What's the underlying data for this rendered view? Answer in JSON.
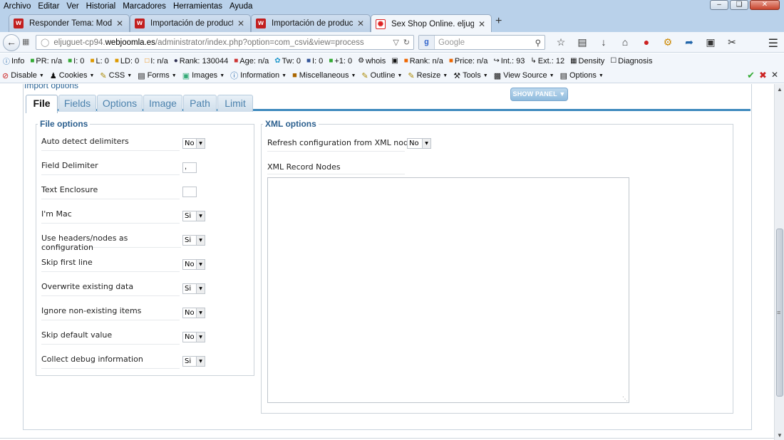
{
  "browser": {
    "menu": [
      "Archivo",
      "Editar",
      "Ver",
      "Historial",
      "Marcadores",
      "Herramientas",
      "Ayuda"
    ],
    "tabs": [
      {
        "label": "Responder Tema: Modifica...",
        "active": false
      },
      {
        "label": "Importación de productos ...",
        "active": false
      },
      {
        "label": "Importación de productos ...",
        "active": false
      },
      {
        "label": "Sex Shop Online. eljuguete...",
        "active": true
      }
    ],
    "url_prefix": "eljuguet-cp94.",
    "url_domain": "webjoomla.es",
    "url_path": "/administrator/index.php?option=com_csvi&view=process",
    "search_placeholder": "Google",
    "search_engine_letter": "g"
  },
  "seo_toolbar": [
    {
      "icon": "info-icon",
      "text": "Info"
    },
    {
      "icon": "google-pr-icon",
      "text": "PR: n/a"
    },
    {
      "icon": "google-index-icon",
      "text": "I: 0"
    },
    {
      "icon": "links-icon",
      "text": "L: 0"
    },
    {
      "icon": "linkdomains-icon",
      "text": "LD: 0"
    },
    {
      "icon": "bing-index-icon",
      "text": "I: n/a"
    },
    {
      "icon": "alexa-icon",
      "text": "Rank: 130044"
    },
    {
      "icon": "age-icon",
      "text": "Age: n/a"
    },
    {
      "icon": "twitter-icon",
      "text": "Tw: 0"
    },
    {
      "icon": "facebook-icon",
      "text": "I: 0"
    },
    {
      "icon": "gplus-icon",
      "text": "+1: 0"
    },
    {
      "icon": "whois-icon",
      "text": "whois"
    },
    {
      "icon": "source-icon",
      "text": ""
    },
    {
      "icon": "semrush-rank-icon",
      "text": "Rank: n/a"
    },
    {
      "icon": "semrush-price-icon",
      "text": "Price: n/a"
    },
    {
      "icon": "internal-links-icon",
      "text": "Int.: 93"
    },
    {
      "icon": "external-links-icon",
      "text": "Ext.: 12"
    },
    {
      "icon": "density-icon",
      "text": "Density"
    },
    {
      "icon": "diagnosis-icon",
      "text": "Diagnosis"
    }
  ],
  "dev_toolbar": [
    "Disable",
    "Cookies",
    "CSS",
    "Forms",
    "Images",
    "Information",
    "Miscellaneous",
    "Outline",
    "Resize",
    "Tools",
    "View Source",
    "Options"
  ],
  "page": {
    "section_legend": "Import options",
    "show_panel": "SHOW PANEL",
    "tabs": [
      {
        "label": "File",
        "active": true
      },
      {
        "label": "Fields",
        "active": false
      },
      {
        "label": "Options",
        "active": false
      },
      {
        "label": "Image",
        "active": false
      },
      {
        "label": "Path",
        "active": false
      },
      {
        "label": "Limit",
        "active": false
      }
    ],
    "file_options": {
      "legend": "File options",
      "rows": [
        {
          "label": "Auto detect delimiters",
          "type": "select",
          "value": "No"
        },
        {
          "label": "Field Delimiter",
          "type": "text",
          "value": ","
        },
        {
          "label": "Text Enclosure",
          "type": "text",
          "value": ""
        },
        {
          "label": "I'm Mac",
          "type": "select",
          "value": "Si"
        },
        {
          "label": "Use headers/nodes as configuration",
          "type": "select",
          "value": "Si"
        },
        {
          "label": "Skip first line",
          "type": "select",
          "value": "No"
        },
        {
          "label": "Overwrite existing data",
          "type": "select",
          "value": "Si"
        },
        {
          "label": "Ignore non-existing items",
          "type": "select",
          "value": "No"
        },
        {
          "label": "Skip default value",
          "type": "select",
          "value": "No"
        },
        {
          "label": "Collect debug information",
          "type": "select",
          "value": "Si"
        }
      ]
    },
    "xml_options": {
      "legend": "XML options",
      "refresh_label": "Refresh configuration from XML nodes",
      "refresh_value": "No",
      "record_nodes_label": "XML Record Nodes",
      "record_nodes_value": ""
    }
  }
}
